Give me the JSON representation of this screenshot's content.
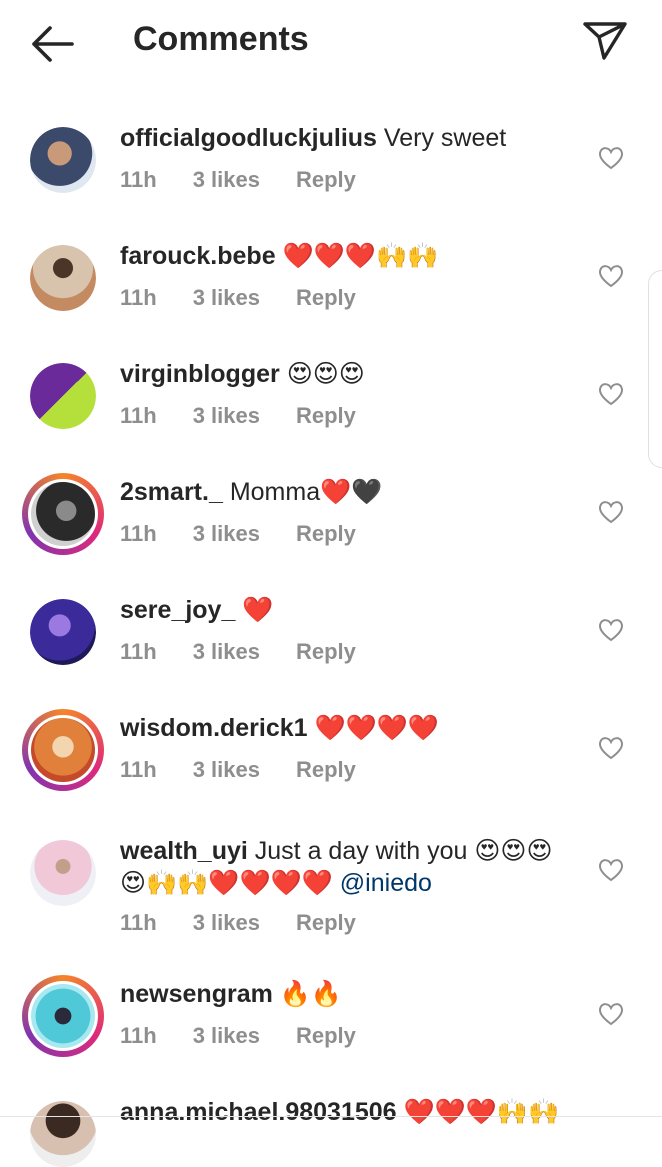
{
  "header": {
    "title": "Comments"
  },
  "comments": [
    {
      "user": "officialgoodluckjulius",
      "text": "Very sweet",
      "time": "11h",
      "likes": "3 likes",
      "reply": "Reply",
      "avatar_color": "#5a6a8a",
      "ring": false
    },
    {
      "user": "farouck.bebe",
      "text": "❤️❤️❤️🙌🙌",
      "time": "11h",
      "likes": "3 likes",
      "reply": "Reply",
      "avatar_color": "#b9a48c",
      "ring": false
    },
    {
      "user": "virginblogger",
      "text": "😍😍😍",
      "time": "11h",
      "likes": "3 likes",
      "reply": "Reply",
      "avatar_color": "#7a2fa0",
      "ring": false
    },
    {
      "user": "2smart._",
      "text": "Momma❤️🖤",
      "time": "11h",
      "likes": "3 likes",
      "reply": "Reply",
      "avatar_color": "#3a3a3a",
      "ring": true
    },
    {
      "user": "sere_joy_",
      "text": "❤️",
      "time": "11h",
      "likes": "3 likes",
      "reply": "Reply",
      "avatar_color": "#4b3aa8",
      "ring": false
    },
    {
      "user": "wisdom.derick1",
      "text": "❤️❤️❤️❤️",
      "time": "11h",
      "likes": "3 likes",
      "reply": "Reply",
      "avatar_color": "#e08a50",
      "ring": true
    },
    {
      "user": "wealth_uyi",
      "text": "Just a day with you 😍😍😍😍🙌🙌❤️❤️❤️❤️",
      "mention": "@iniedo",
      "time": "11h",
      "likes": "3 likes",
      "reply": "Reply",
      "avatar_color": "#e6b3c8",
      "ring": false
    },
    {
      "user": "newsengram",
      "text": "🔥🔥",
      "time": "11h",
      "likes": "3 likes",
      "reply": "Reply",
      "avatar_color": "#3fb8c8",
      "ring": true
    },
    {
      "user": "anna.michael.98031506",
      "text": "❤️❤️❤️🙌🙌",
      "avatar_color": "#222222",
      "ring": false
    }
  ]
}
